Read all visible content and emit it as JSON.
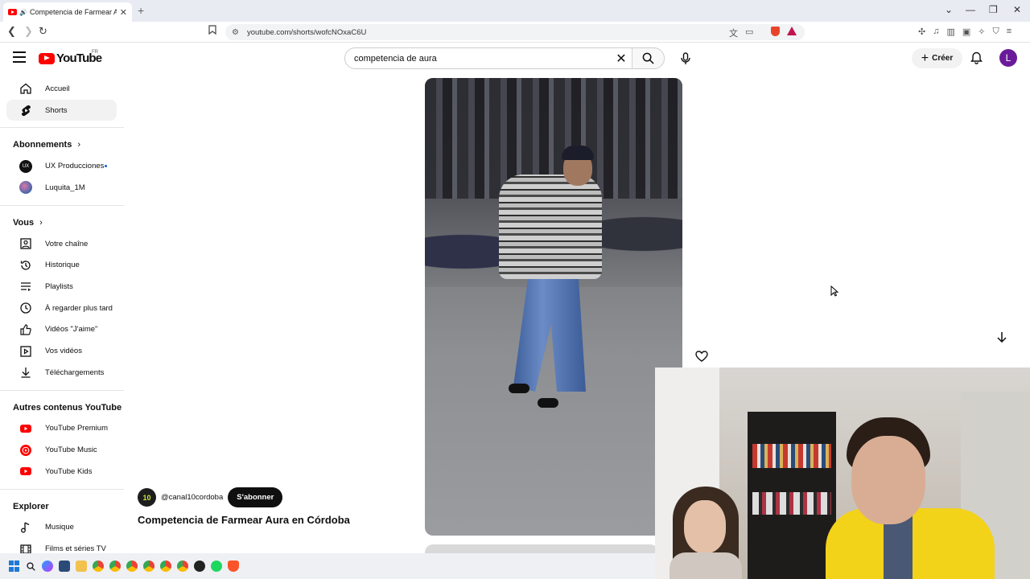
{
  "browser": {
    "tab_title": "Competencia de Farmear Aura en Córdoba",
    "url": "youtube.com/shorts/wofcNOxaC6U"
  },
  "header": {
    "logo_text": "YouTube",
    "country_code": "FR",
    "search_value": "competencia de aura",
    "create_label": "Créer",
    "avatar_letter": "L"
  },
  "sidebar": {
    "main": [
      {
        "label": "Accueil",
        "icon": "home-icon"
      },
      {
        "label": "Shorts",
        "icon": "shorts-icon",
        "active": true
      }
    ],
    "subscriptions_heading": "Abonnements",
    "subscriptions": [
      {
        "label": "UX Producciones",
        "new_content": true
      },
      {
        "label": "Luquita_1M"
      }
    ],
    "you_heading": "Vous",
    "you": [
      {
        "label": "Votre chaîne",
        "icon": "channel-icon"
      },
      {
        "label": "Historique",
        "icon": "history-icon"
      },
      {
        "label": "Playlists",
        "icon": "playlists-icon"
      },
      {
        "label": "À regarder plus tard",
        "icon": "watch-later-icon"
      },
      {
        "label": "Vidéos \"J'aime\"",
        "icon": "liked-icon"
      },
      {
        "label": "Vos vidéos",
        "icon": "your-videos-icon"
      },
      {
        "label": "Téléchargements",
        "icon": "downloads-icon"
      }
    ],
    "more_heading": "Autres contenus YouTube",
    "more": [
      {
        "label": "YouTube Premium"
      },
      {
        "label": "YouTube Music"
      },
      {
        "label": "YouTube Kids"
      }
    ],
    "explore_heading": "Explorer",
    "explore": [
      {
        "label": "Musique",
        "icon": "music-icon"
      },
      {
        "label": "Films et séries TV",
        "icon": "films-icon"
      }
    ]
  },
  "short": {
    "channel_handle": "@canal10cordoba",
    "subscribe_label": "S'abonner",
    "title": "Competencia de Farmear Aura en Córdoba"
  },
  "colors": {
    "brand_red": "#ff0000",
    "text": "#0f0f0f",
    "link_blue": "#065fd4"
  }
}
